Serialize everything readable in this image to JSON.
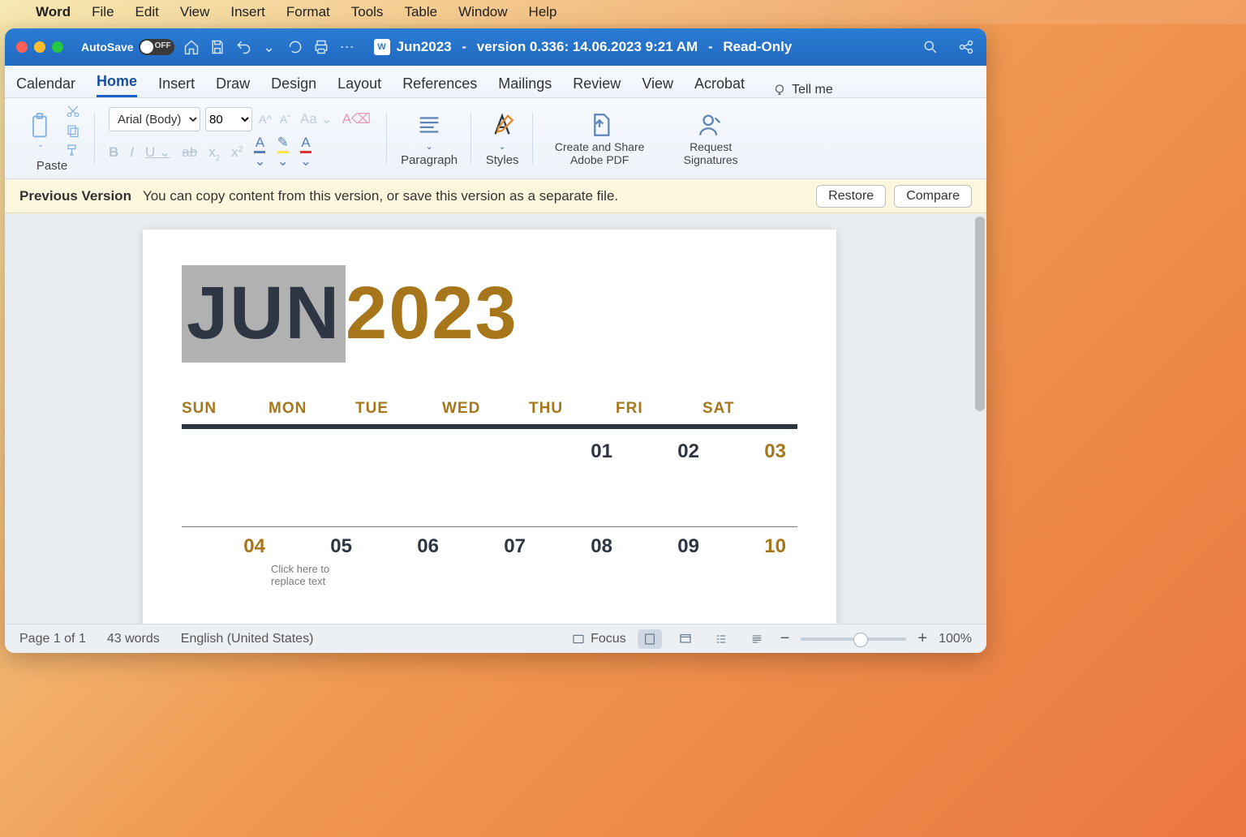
{
  "menubar": {
    "app": "Word",
    "items": [
      "File",
      "Edit",
      "View",
      "Insert",
      "Format",
      "Tools",
      "Table",
      "Window",
      "Help"
    ]
  },
  "titlebar": {
    "autosave_label": "AutoSave",
    "autosave_state": "OFF",
    "doc_name": "Jun2023",
    "version_info": "version 0.336: 14.06.2023 9:21 AM",
    "readonly": "Read-Only"
  },
  "tabs": [
    "Calendar",
    "Home",
    "Insert",
    "Draw",
    "Design",
    "Layout",
    "References",
    "Mailings",
    "Review",
    "View",
    "Acrobat"
  ],
  "tellme": "Tell me",
  "ribbon": {
    "paste": "Paste",
    "font_name": "Arial (Body)",
    "font_size": "80",
    "paragraph": "Paragraph",
    "styles": "Styles",
    "adobe": "Create and Share Adobe PDF",
    "sign": "Request Signatures"
  },
  "notice": {
    "title": "Previous Version",
    "msg": "You can copy content from this version, or save this version as a separate file.",
    "restore": "Restore",
    "compare": "Compare"
  },
  "calendar": {
    "month": "JUN",
    "year": "2023",
    "days": [
      "SUN",
      "MON",
      "TUE",
      "WED",
      "THU",
      "FRI",
      "SAT"
    ],
    "row1": [
      "",
      "",
      "",
      "",
      "01",
      "02",
      "03"
    ],
    "row2": [
      "04",
      "05",
      "06",
      "07",
      "08",
      "09",
      "10"
    ],
    "placeholder": "Click here to replace text"
  },
  "status": {
    "page": "Page 1 of 1",
    "words": "43 words",
    "lang": "English (United States)",
    "focus": "Focus",
    "zoom": "100%"
  }
}
